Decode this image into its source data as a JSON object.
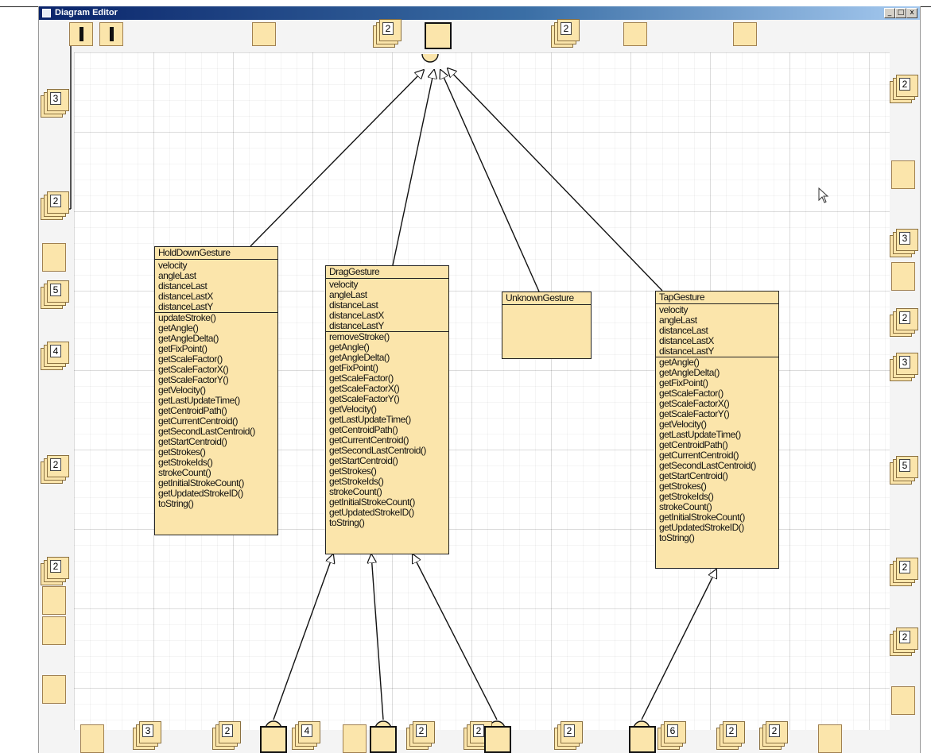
{
  "window": {
    "title": "Diagram Editor",
    "buttons": [
      "_",
      "□",
      "x"
    ]
  },
  "palette_counts": {
    "top": [
      "2",
      "2"
    ],
    "left": [
      "3",
      "2",
      "5",
      "4",
      "2",
      "2"
    ],
    "right": [
      "2",
      "3",
      "2",
      "3",
      "5",
      "2",
      "2"
    ],
    "bottom": [
      "3",
      "2",
      "4",
      "2",
      "2",
      "2",
      "6",
      "2",
      "2"
    ]
  },
  "classes": [
    {
      "name": "HoldDownGesture",
      "fields": [
        "velocity",
        "angleLast",
        "distanceLast",
        "distanceLastX",
        "distanceLastY"
      ],
      "methods": [
        "updateStroke()",
        "getAngle()",
        "getAngleDelta()",
        "getFixPoint()",
        "getScaleFactor()",
        "getScaleFactorX()",
        "getScaleFactorY()",
        "getVelocity()",
        "getLastUpdateTime()",
        "getCentroidPath()",
        "getCurrentCentroid()",
        "getSecondLastCentroid()",
        "getStartCentroid()",
        "getStrokes()",
        "getStrokeIds()",
        "strokeCount()",
        "getInitialStrokeCount()",
        "getUpdatedStrokeID()",
        "toString()"
      ]
    },
    {
      "name": "DragGesture",
      "fields": [
        "velocity",
        "angleLast",
        "distanceLast",
        "distanceLastX",
        "distanceLastY"
      ],
      "methods": [
        "removeStroke()",
        "getAngle()",
        "getAngleDelta()",
        "getFixPoint()",
        "getScaleFactor()",
        "getScaleFactorX()",
        "getScaleFactorY()",
        "getVelocity()",
        "getLastUpdateTime()",
        "getCentroidPath()",
        "getCurrentCentroid()",
        "getSecondLastCentroid()",
        "getStartCentroid()",
        "getStrokes()",
        "getStrokeIds()",
        "strokeCount()",
        "getInitialStrokeCount()",
        "getUpdatedStrokeID()",
        "toString()"
      ]
    },
    {
      "name": "UnknownGesture",
      "fields": [],
      "methods": []
    },
    {
      "name": "TapGesture",
      "fields": [
        "velocity",
        "angleLast",
        "distanceLast",
        "distanceLastX",
        "distanceLastY"
      ],
      "methods": [
        "getAngle()",
        "getAngleDelta()",
        "getFixPoint()",
        "getScaleFactor()",
        "getScaleFactorX()",
        "getScaleFactorY()",
        "getVelocity()",
        "getLastUpdateTime()",
        "getCentroidPath()",
        "getCurrentCentroid()",
        "getSecondLastCentroid()",
        "getStartCentroid()",
        "getStrokes()",
        "getStrokeIds()",
        "strokeCount()",
        "getInitialStrokeCount()",
        "getUpdatedStrokeID()",
        "toString()"
      ]
    }
  ],
  "colors": {
    "class_fill": "#fbe5ab",
    "titlebar_start": "#0a246a",
    "titlebar_end": "#a6caf0"
  }
}
